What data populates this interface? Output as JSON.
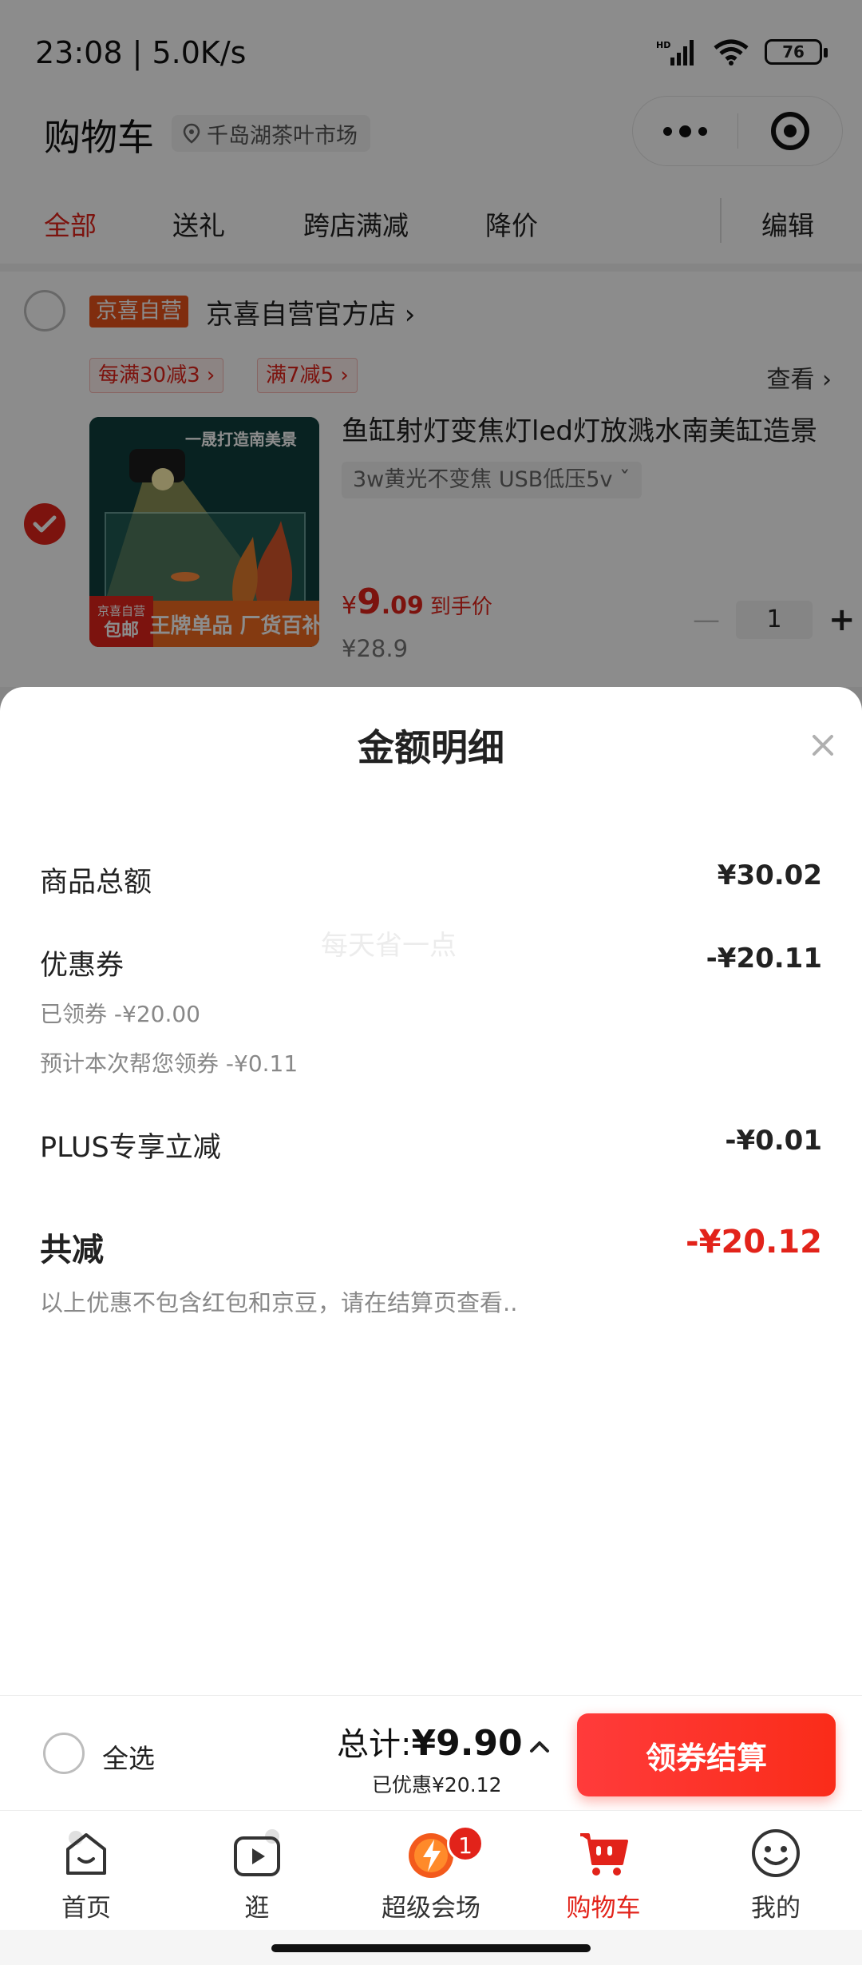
{
  "status_bar": {
    "time": "23:08 | 5.0K/s",
    "battery": "76"
  },
  "header": {
    "title": "购物车",
    "location": "千岛湖茶叶市场"
  },
  "tabs": [
    "全部",
    "送礼",
    "跨店满减",
    "降价"
  ],
  "edit_label": "编辑",
  "store": {
    "badge": "京喜自营",
    "name": "京喜自营官方店 ›",
    "promos": [
      "每满30减3 ›",
      "满7减5 ›"
    ],
    "view_label": "查看 ›"
  },
  "product": {
    "title": "鱼缸射灯变焦灯led灯放溅水南美缸造景",
    "spec": "3w黄光不变焦 USB低压5v  ˇ",
    "price_symbol": "¥",
    "price_int": "9",
    "price_dec": ".09",
    "price_label": "到手价",
    "original_price": "¥28.9",
    "quantity": "1",
    "image_text_top": "一晟打造南美景",
    "image_tag_top": "京喜自营",
    "image_tag_bottom": "包邮",
    "image_banner": "王牌单品 厂货百补"
  },
  "sheet": {
    "title": "金额明细",
    "watermark": "每天省一点",
    "rows": {
      "goods_total_label": "商品总额",
      "goods_total_value": "¥30.02",
      "coupon_label": "优惠券",
      "coupon_value": "-¥20.11",
      "coupon_claimed": "已领券 -¥20.00",
      "coupon_estimated": "预计本次帮您领券 -¥0.11",
      "plus_label": "PLUS专享立减",
      "plus_value": "-¥0.01",
      "total_off_label": "共减",
      "total_off_value": "-¥20.12",
      "note": "以上优惠不包含红包和京豆，请在结算页查看.."
    }
  },
  "checkout": {
    "select_all": "全选",
    "sum_prefix": "总计:",
    "sum_amount": "¥9.90",
    "saved": "已优惠¥20.12",
    "button": "领券结算"
  },
  "tab_bar": {
    "items": [
      "首页",
      "逛",
      "超级会场",
      "购物车",
      "我的"
    ],
    "badge": "1",
    "active": "购物车"
  },
  "colors": {
    "accent": "#e2231a",
    "button": "#fa2c19"
  }
}
